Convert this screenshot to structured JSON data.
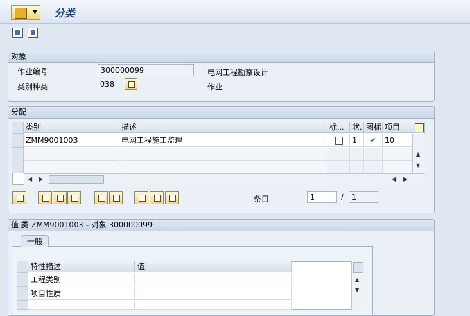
{
  "window": {
    "title": "分类"
  },
  "object_group": {
    "header": "对象",
    "job_no_label": "作业编号",
    "job_no_value": "300000099",
    "job_no_desc": "电网工程勘察设计",
    "class_type_label": "类别种类",
    "class_type_value": "038",
    "class_type_desc": "作业"
  },
  "assign_group": {
    "header": "分配",
    "columns": [
      "类别",
      "描述",
      "标...",
      "状.",
      "图标",
      "项目"
    ],
    "rows": [
      {
        "class": "ZMM9001003",
        "desc": "电网工程施工监理",
        "std": "",
        "status": "1",
        "icon": "check-icon",
        "item": "10"
      }
    ],
    "entry_label": "条目",
    "entry_current": "1",
    "entry_separator": "/",
    "entry_total": "1"
  },
  "values_group": {
    "header": "值 类 ZMM9001003 - 对象 300000099",
    "tab_label": "一般",
    "columns": [
      "特性描述",
      "值"
    ],
    "rows": [
      {
        "char": "工程类别",
        "value": ""
      },
      {
        "char": "项目性质",
        "value": ""
      },
      {
        "char": "",
        "value": ""
      }
    ]
  },
  "colors": {
    "accent": "#1b3f6e",
    "check": "#1f8a1f"
  }
}
